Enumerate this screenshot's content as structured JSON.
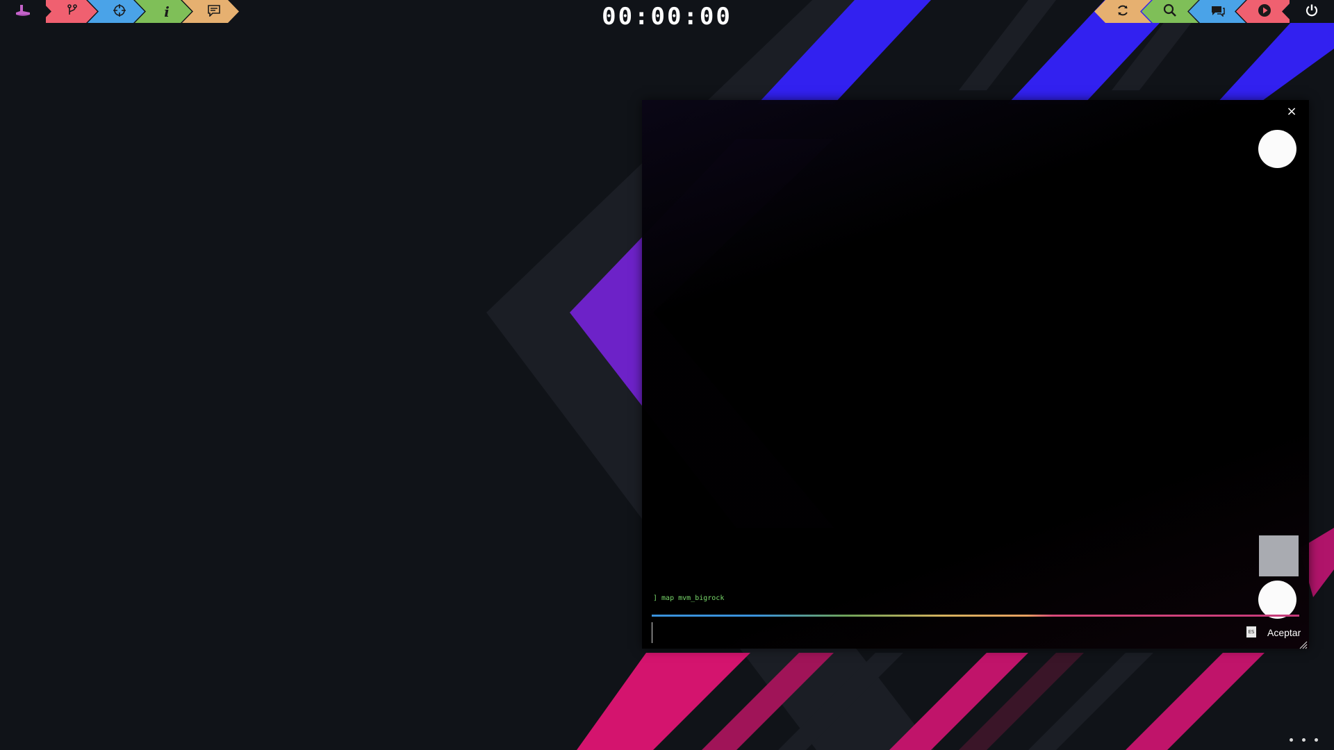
{
  "toolbar_left": {
    "items": [
      {
        "name": "home",
        "icon": "hat-icon",
        "color": "#c463c9"
      },
      {
        "name": "branch",
        "icon": "fork-icon",
        "glyph": "⑂",
        "color": "#f06070"
      },
      {
        "name": "target",
        "icon": "crosshair-icon",
        "glyph": "⊕",
        "color": "#4aa3e8"
      },
      {
        "name": "info",
        "icon": "info-icon",
        "glyph": "i",
        "color": "#7fbf58"
      },
      {
        "name": "chat",
        "icon": "message-icon",
        "glyph": "☰",
        "color": "#e6b070"
      }
    ]
  },
  "clock": {
    "time": "00:00:00"
  },
  "toolbar_right": {
    "items": [
      {
        "name": "refresh",
        "icon": "refresh-icon",
        "glyph": "⟳",
        "color": "#e6b070"
      },
      {
        "name": "search",
        "icon": "search-icon",
        "glyph": "⚲",
        "color": "#7fbf58"
      },
      {
        "name": "chat",
        "icon": "chat-bubbles-icon",
        "glyph": "●",
        "color": "#4aa3e8"
      },
      {
        "name": "play",
        "icon": "play-icon",
        "glyph": "▶",
        "color": "#f06070"
      }
    ],
    "power_icon": "power-icon"
  },
  "console": {
    "close_label": "×",
    "log_line": "] map mvm_bigrock",
    "input_value": "",
    "input_placeholder": "",
    "lang_badge": "ES",
    "accept_label": "Aceptar"
  },
  "colors": {
    "background": "#101318",
    "stripe_blue": "#3222ff",
    "stripe_purple": "#6a1fd0",
    "stripe_pink": "#e01478",
    "stripe_gray": "#1d2027"
  }
}
